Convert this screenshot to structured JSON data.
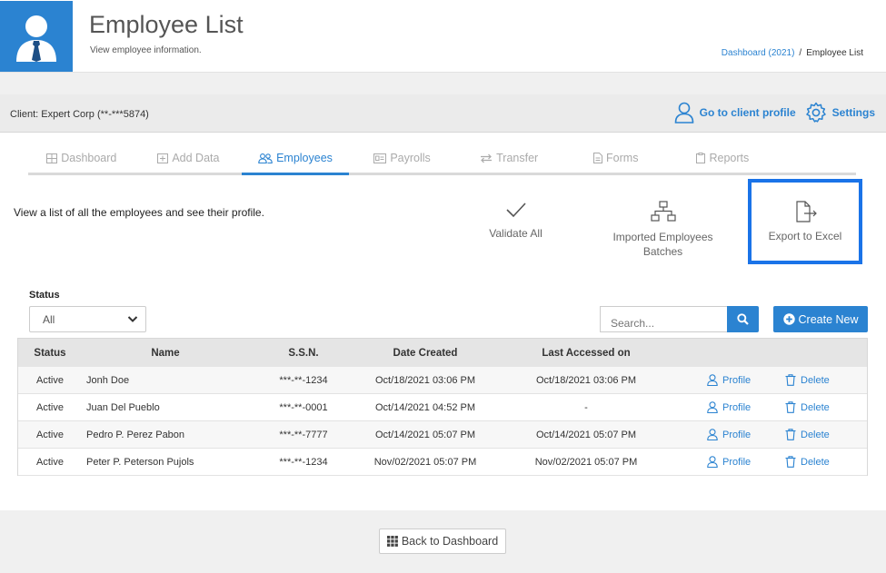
{
  "header": {
    "title": "Employee List",
    "subtitle": "View employee information.",
    "breadcrumb": {
      "link_label": "Dashboard (2021)",
      "separator": "/",
      "current": "Employee List"
    }
  },
  "client_bar": {
    "label": "Client: Expert Corp (**-***5874)",
    "go_to_profile_label": "Go to client profile",
    "settings_label": "Settings"
  },
  "tabs": [
    {
      "label": "Dashboard",
      "icon": "table-icon"
    },
    {
      "label": "Add Data",
      "icon": "plus-square-icon"
    },
    {
      "label": "Employees",
      "icon": "users-icon",
      "active": true
    },
    {
      "label": "Payrolls",
      "icon": "id-card-icon"
    },
    {
      "label": "Transfer",
      "icon": "exchange-icon"
    },
    {
      "label": "Forms",
      "icon": "document-icon"
    },
    {
      "label": "Reports",
      "icon": "clipboard-icon"
    }
  ],
  "intro": "View a list of all the employees and see their profile.",
  "actions": {
    "validate_all": "Validate All",
    "imported_batches_line1": "Imported Employees",
    "imported_batches_line2": "Batches",
    "export_excel": "Export to Excel"
  },
  "filters": {
    "status_label": "Status",
    "status_value": "All",
    "search_placeholder": "Search...",
    "create_new_label": "Create New"
  },
  "table": {
    "columns": [
      "Status",
      "Name",
      "S.S.N.",
      "Date Created",
      "Last Accessed on"
    ],
    "profile_label": "Profile",
    "delete_label": "Delete",
    "rows": [
      {
        "status": "Active",
        "name": "Jonh Doe",
        "ssn": "***-**-1234",
        "created": "Oct/18/2021 03:06 PM",
        "accessed": "Oct/18/2021 03:06 PM"
      },
      {
        "status": "Active",
        "name": "Juan Del Pueblo",
        "ssn": "***-**-0001",
        "created": "Oct/14/2021 04:52 PM",
        "accessed": "-"
      },
      {
        "status": "Active",
        "name": "Pedro P. Perez Pabon",
        "ssn": "***-**-7777",
        "created": "Oct/14/2021 05:07 PM",
        "accessed": "Oct/14/2021 05:07 PM"
      },
      {
        "status": "Active",
        "name": "Peter P. Peterson Pujols",
        "ssn": "***-**-1234",
        "created": "Nov/02/2021 05:07 PM",
        "accessed": "Nov/02/2021 05:07 PM"
      }
    ]
  },
  "footer": {
    "back_label": "Back to Dashboard"
  },
  "colors": {
    "accent": "#2b83d1",
    "highlight_border": "#1a73e8"
  }
}
